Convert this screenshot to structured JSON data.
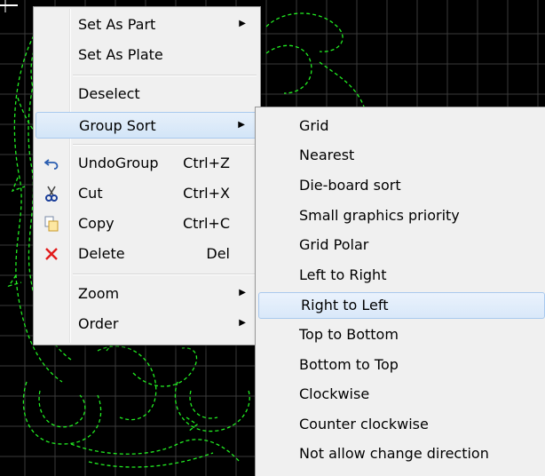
{
  "colors": {
    "background": "#000000",
    "grid": "#3a3a3a",
    "drawing": "#22ee22",
    "menu_bg": "#f0f0f0",
    "highlight": "#d3e5f8"
  },
  "context_menu": {
    "items": [
      {
        "label": "Set As Part",
        "submenu": true
      },
      {
        "label": "Set As Plate"
      },
      {
        "label": "Deselect"
      },
      {
        "label": "Group Sort",
        "submenu": true,
        "highlighted": true
      },
      {
        "label": "UndoGroup",
        "shortcut": "Ctrl+Z",
        "icon": "undo-icon"
      },
      {
        "label": "Cut",
        "shortcut": "Ctrl+X",
        "icon": "scissors-icon"
      },
      {
        "label": "Copy",
        "shortcut": "Ctrl+C",
        "icon": "copy-icon"
      },
      {
        "label": "Delete",
        "shortcut": "Del",
        "icon": "delete-x-icon"
      },
      {
        "label": "Zoom",
        "submenu": true
      },
      {
        "label": "Order",
        "submenu": true
      }
    ]
  },
  "group_sort_submenu": {
    "items": [
      "Grid",
      "Nearest",
      "Die-board sort",
      "Small graphics priority",
      "Grid Polar",
      "Left to Right",
      "Right to Left",
      "Top to Bottom",
      "Bottom to Top",
      "Clockwise",
      "Counter clockwise",
      "Not allow change direction"
    ],
    "highlighted_item": "Right to Left"
  },
  "icons": {
    "submenu_arrow": "▶"
  }
}
